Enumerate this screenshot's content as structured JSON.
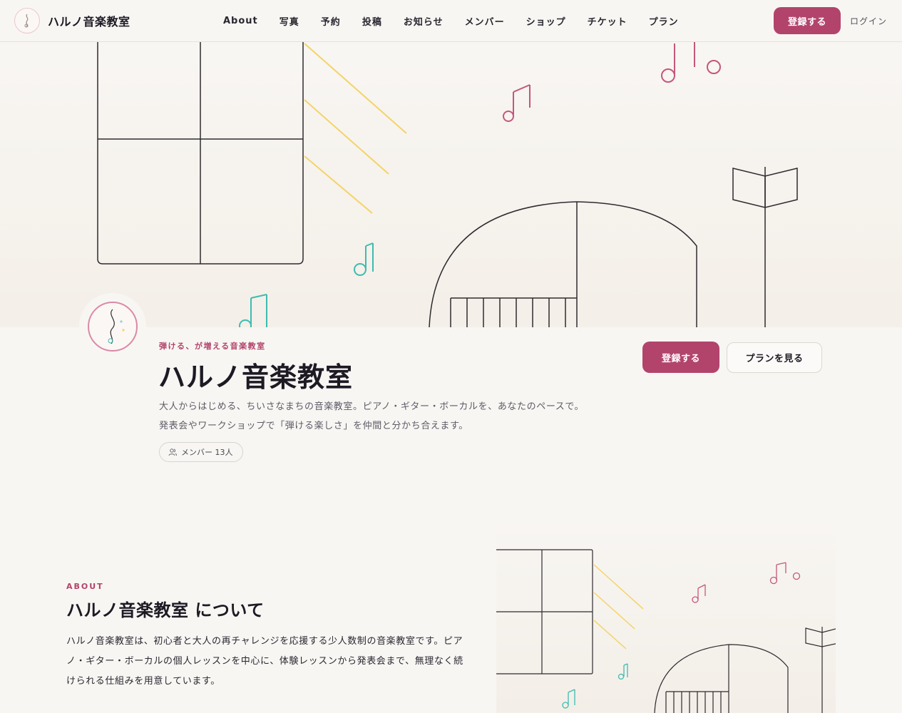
{
  "header": {
    "brand_name": "ハルノ音楽教室",
    "nav": [
      "About",
      "写真",
      "予約",
      "投稿",
      "お知らせ",
      "メンバー",
      "ショップ",
      "チケット",
      "プラン"
    ],
    "register_label": "登録する",
    "login_label": "ログイン"
  },
  "profile": {
    "tagline": "弾ける、が増える音楽教室",
    "title": "ハルノ音楽教室",
    "description_line1": "大人からはじめる、ちいさなまちの音楽教室。ピアノ・ギター・ボーカルを、あなたのペースで。",
    "description_line2": "発表会やワークショップで「弾ける楽しさ」を仲間と分かち合えます。",
    "members_badge": "メンバー 13人",
    "join_label": "登録する",
    "plan_label": "プランを見る"
  },
  "about": {
    "label": "ABOUT",
    "title": "ハルノ音楽教室 について",
    "body": "ハルノ音楽教室は、初心者と大人の再チャレンジを応援する少人数制の音楽教室です。ピアノ・ギター・ボーカルの個人レッスンを中心に、体験レッスンから発表会まで、無理なく続けられる仕組みを用意しています。"
  },
  "colors": {
    "accent": "#b2446c",
    "background": "#f8f6f3",
    "note_teal": "#3dbcb0",
    "note_pink": "#c4577c",
    "sun_yellow": "#f3d468"
  },
  "icons": [
    "treble-clef-icon",
    "users-icon",
    "music-note-icon"
  ]
}
